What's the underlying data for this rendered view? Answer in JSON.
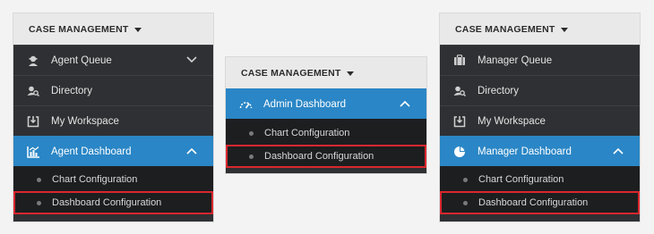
{
  "left_panel": {
    "header": "CASE MANAGEMENT",
    "items": [
      {
        "label": "Agent Queue",
        "icon": "agent-icon"
      },
      {
        "label": "Directory",
        "icon": "directory-icon"
      },
      {
        "label": "My Workspace",
        "icon": "workspace-icon"
      },
      {
        "label": "Agent Dashboard",
        "icon": "chart-icon"
      }
    ],
    "subitems": [
      {
        "label": "Chart Configuration"
      },
      {
        "label": "Dashboard Configuration"
      }
    ]
  },
  "middle_panel": {
    "header": "CASE MANAGEMENT",
    "items": [
      {
        "label": "Admin Dashboard",
        "icon": "gauge-icon"
      }
    ],
    "subitems": [
      {
        "label": "Chart Configuration"
      },
      {
        "label": "Dashboard Configuration"
      }
    ]
  },
  "right_panel": {
    "header": "CASE MANAGEMENT",
    "items": [
      {
        "label": "Manager Queue",
        "icon": "briefcase-icon"
      },
      {
        "label": "Directory",
        "icon": "directory-icon"
      },
      {
        "label": "My Workspace",
        "icon": "workspace-icon"
      },
      {
        "label": "Manager Dashboard",
        "icon": "pie-chart-icon"
      }
    ],
    "subitems": [
      {
        "label": "Chart Configuration"
      },
      {
        "label": "Dashboard Configuration"
      }
    ]
  },
  "colors": {
    "active": "#2a86c6",
    "highlight": "#d9272e",
    "panel_bg": "#2f3033",
    "sub_bg": "#1d1e20"
  }
}
